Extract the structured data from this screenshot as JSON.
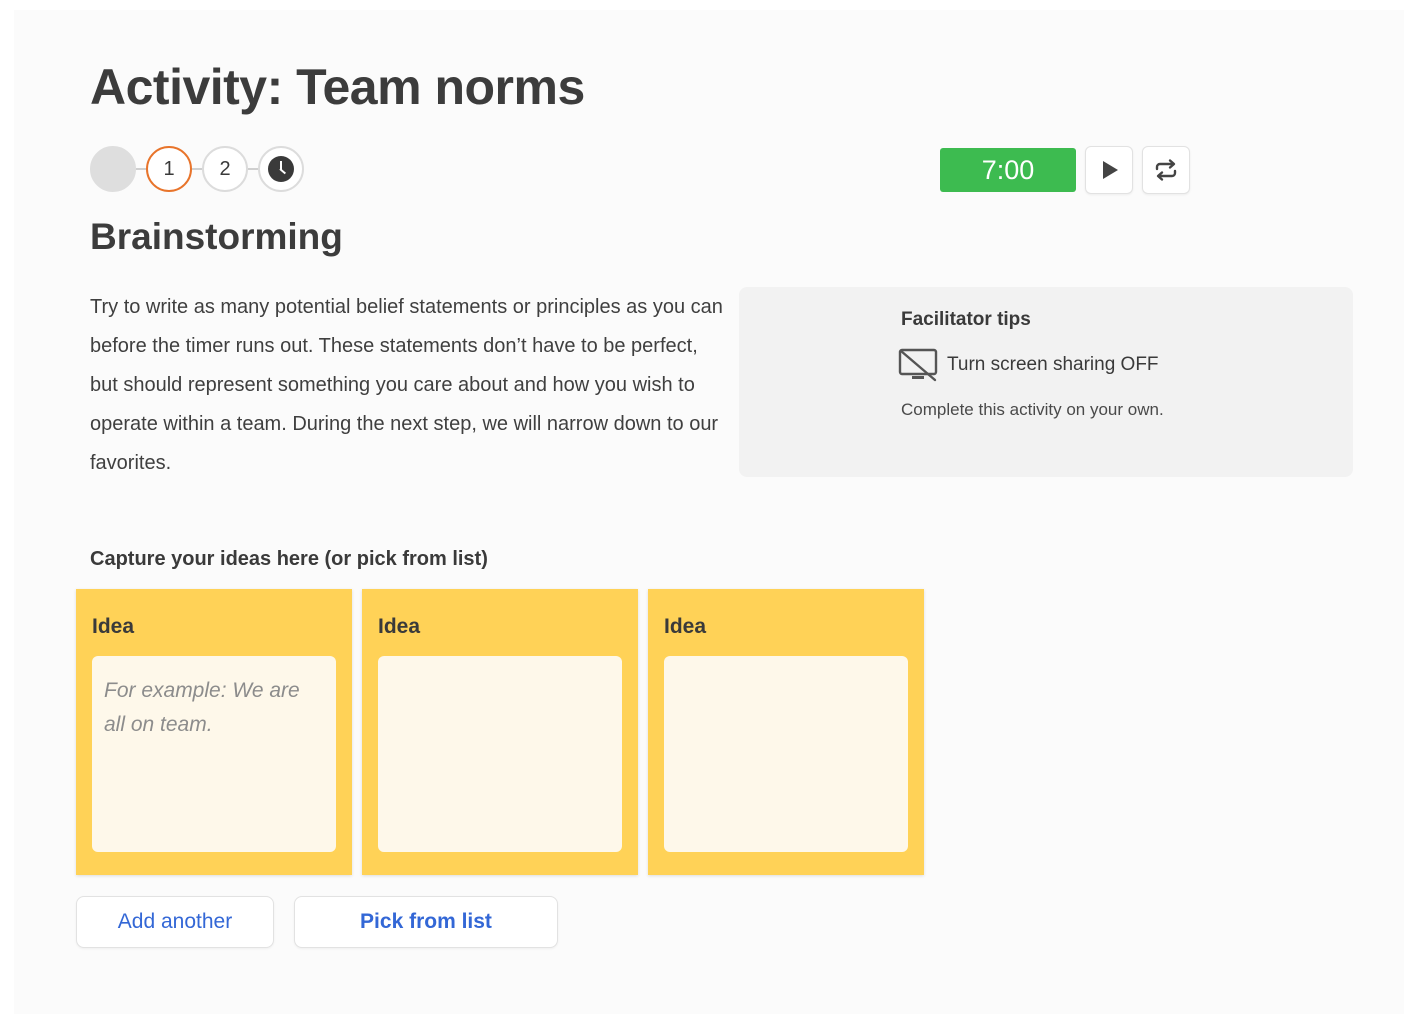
{
  "page_title": "Activity: Team norms",
  "stepper": {
    "steps": [
      "1",
      "2"
    ],
    "clock_icon": "clock-icon",
    "current_step_color": "#e8742b"
  },
  "timer": {
    "value": "7:00",
    "color": "#3dbb50",
    "play_icon": "play-icon",
    "reset_icon": "repeat-icon"
  },
  "section_title": "Brainstorming",
  "description": "Try to write as many potential belief statements or principles as you can before the timer runs out. These statements don’t have to be perfect, but should represent something you care about and how you wish to operate within a team. During the next step, we will narrow down to our favorites.",
  "facilitator_tips": {
    "title": "Facilitator tips",
    "icon": "screen-share-off-icon",
    "sharing": "Turn screen sharing OFF",
    "note": "Complete this activity on your own."
  },
  "capture_label": "Capture your ideas here (or pick from list)",
  "ideas": [
    {
      "label": "Idea",
      "value": "",
      "placeholder": "For example: We are all on team."
    },
    {
      "label": "Idea",
      "value": "",
      "placeholder": ""
    },
    {
      "label": "Idea",
      "value": "",
      "placeholder": ""
    }
  ],
  "card_color": "#ffd257",
  "buttons": {
    "add_another": "Add another",
    "pick_from_list": "Pick from list",
    "link_color": "#3367d6"
  }
}
